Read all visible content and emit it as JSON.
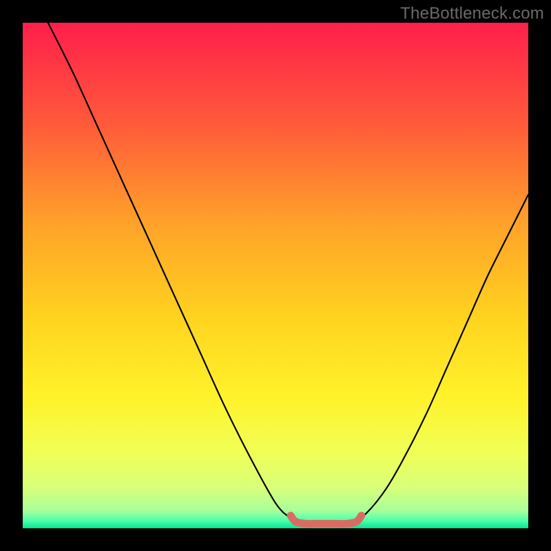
{
  "watermark": "TheBottleneck.com",
  "chart_data": {
    "type": "line",
    "title": "",
    "xlabel": "",
    "ylabel": "",
    "xlim": [
      0,
      100
    ],
    "ylim": [
      0,
      100
    ],
    "grid": false,
    "legend": false,
    "series": [
      {
        "name": "left-curve",
        "x": [
          5,
          10,
          15,
          20,
          25,
          30,
          35,
          40,
          45,
          50,
          53,
          55
        ],
        "y": [
          100,
          90,
          79,
          68,
          57,
          46,
          35,
          24,
          14,
          5,
          2,
          1
        ]
      },
      {
        "name": "right-curve",
        "x": [
          65,
          68,
          72,
          76,
          80,
          84,
          88,
          92,
          96,
          100
        ],
        "y": [
          1,
          3,
          8,
          15,
          23,
          32,
          41,
          50,
          58,
          66
        ]
      },
      {
        "name": "bottom-bracket",
        "x": [
          53,
          54,
          56,
          58,
          60,
          62,
          64,
          66,
          67
        ],
        "y": [
          2.5,
          1.3,
          0.9,
          0.9,
          0.9,
          0.9,
          0.9,
          1.3,
          2.5
        ]
      }
    ],
    "gradient_stops": [
      {
        "offset": 0.0,
        "color": "#ff1f4b"
      },
      {
        "offset": 0.2,
        "color": "#ff5a3a"
      },
      {
        "offset": 0.4,
        "color": "#ffa329"
      },
      {
        "offset": 0.58,
        "color": "#ffd21f"
      },
      {
        "offset": 0.74,
        "color": "#fff22a"
      },
      {
        "offset": 0.85,
        "color": "#f0ff55"
      },
      {
        "offset": 0.92,
        "color": "#d8ff7a"
      },
      {
        "offset": 0.965,
        "color": "#a8ff9a"
      },
      {
        "offset": 0.985,
        "color": "#4dffac"
      },
      {
        "offset": 1.0,
        "color": "#00e58f"
      }
    ],
    "bracket_color": "#d96c62",
    "curve_color": "#000000"
  }
}
